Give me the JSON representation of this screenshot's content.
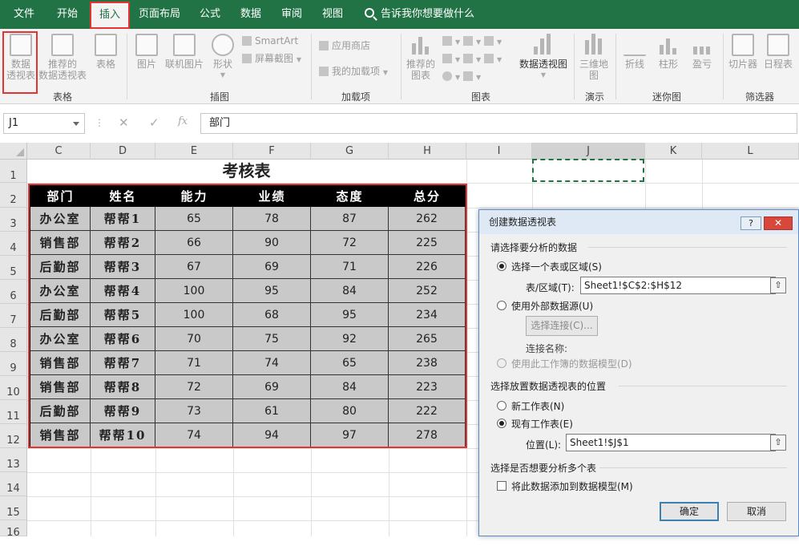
{
  "ribbon_tabs": [
    "文件",
    "开始",
    "插入",
    "页面布局",
    "公式",
    "数据",
    "审阅",
    "视图"
  ],
  "active_tab": "插入",
  "tell_me": "告诉我你想要做什么",
  "ribbon": {
    "pivot_table": "数据\n透视表",
    "recommended_pivot": "推荐的\n数据透视表",
    "table": "表格",
    "picture": "图片",
    "online_picture": "联机图片",
    "shapes": "形状",
    "smartart": "SmartArt",
    "screenshot": "屏幕截图",
    "store": "应用商店",
    "my_addins": "我的加载项",
    "recommended_charts": "推荐的\n图表",
    "pivot_chart": "数据透视图",
    "map3d": "三维地\n图",
    "line": "折线",
    "column": "柱形",
    "winloss": "盈亏",
    "slicer": "切片器",
    "timeline": "日程表",
    "groups": [
      "表格",
      "插图",
      "加载项",
      "图表",
      "演示",
      "迷你图",
      "筛选器"
    ]
  },
  "formula_bar": {
    "name_box": "J1",
    "value": "部门",
    "fx": "fx"
  },
  "columns": [
    "C",
    "D",
    "E",
    "F",
    "G",
    "H",
    "I",
    "J",
    "K",
    "L"
  ],
  "rows": [
    "1",
    "2",
    "3",
    "4",
    "5",
    "6",
    "7",
    "8",
    "9",
    "10",
    "11",
    "12",
    "13",
    "14",
    "15",
    "16"
  ],
  "sheet": {
    "title": "考核表",
    "headers": [
      "部门",
      "姓名",
      "能力",
      "业绩",
      "态度",
      "总分"
    ],
    "data": [
      [
        "办公室",
        "帮帮1",
        "65",
        "78",
        "87",
        "262"
      ],
      [
        "销售部",
        "帮帮2",
        "66",
        "90",
        "72",
        "225"
      ],
      [
        "后勤部",
        "帮帮3",
        "67",
        "69",
        "71",
        "226"
      ],
      [
        "办公室",
        "帮帮4",
        "100",
        "95",
        "84",
        "252"
      ],
      [
        "后勤部",
        "帮帮5",
        "100",
        "68",
        "95",
        "234"
      ],
      [
        "办公室",
        "帮帮6",
        "70",
        "75",
        "92",
        "265"
      ],
      [
        "销售部",
        "帮帮7",
        "71",
        "74",
        "65",
        "238"
      ],
      [
        "销售部",
        "帮帮8",
        "72",
        "69",
        "84",
        "223"
      ],
      [
        "后勤部",
        "帮帮9",
        "73",
        "61",
        "80",
        "222"
      ],
      [
        "销售部",
        "帮帮10",
        "74",
        "94",
        "97",
        "278"
      ]
    ]
  },
  "dialog": {
    "title": "创建数据透视表",
    "help": "?",
    "close": "✕",
    "section1": "请选择要分析的数据",
    "opt_range": "选择一个表或区域(S)",
    "range_label": "表/区域(T):",
    "range_value": "Sheet1!$C$2:$H$12",
    "opt_external": "使用外部数据源(U)",
    "select_conn": "选择连接(C)...",
    "conn_name": "连接名称:",
    "opt_model": "使用此工作簿的数据模型(D)",
    "section2": "选择放置数据透视表的位置",
    "opt_new": "新工作表(N)",
    "opt_existing": "现有工作表(E)",
    "loc_label": "位置(L):",
    "loc_value": "Sheet1!$J$1",
    "section3": "选择是否想要分析多个表",
    "add_model": "将此数据添加到数据模型(M)",
    "ok": "确定",
    "cancel": "取消"
  }
}
